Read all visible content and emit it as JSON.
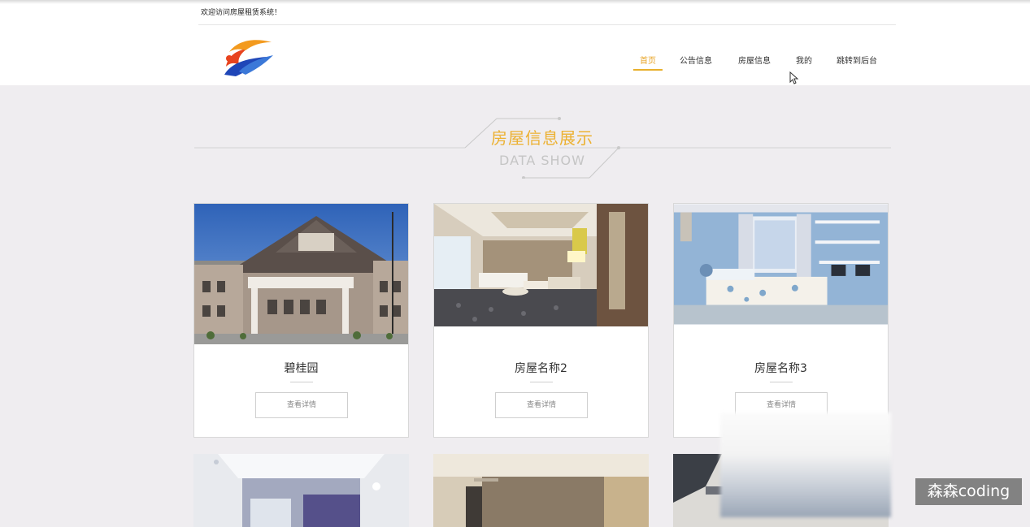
{
  "header": {
    "welcome_text": "欢迎访问房屋租赁系统！",
    "nav": [
      {
        "label": "首页",
        "active": true
      },
      {
        "label": "公告信息",
        "active": false
      },
      {
        "label": "房屋信息",
        "active": false
      },
      {
        "label": "我的",
        "active": false
      },
      {
        "label": "跳转到后台",
        "active": false
      }
    ]
  },
  "section": {
    "title_zh": "房屋信息展示",
    "title_en": "DATA SHOW"
  },
  "cards": [
    {
      "name": "碧桂园",
      "button": "查看详情",
      "image": "hotel-exterior-photo"
    },
    {
      "name": "房屋名称2",
      "button": "查看详情",
      "image": "hotel-room-photo"
    },
    {
      "name": "房屋名称3",
      "button": "查看详情",
      "image": "kids-bedroom-photo"
    }
  ],
  "watermark": "森森coding",
  "colors": {
    "accent": "#ecb132",
    "background": "#efedf0"
  }
}
